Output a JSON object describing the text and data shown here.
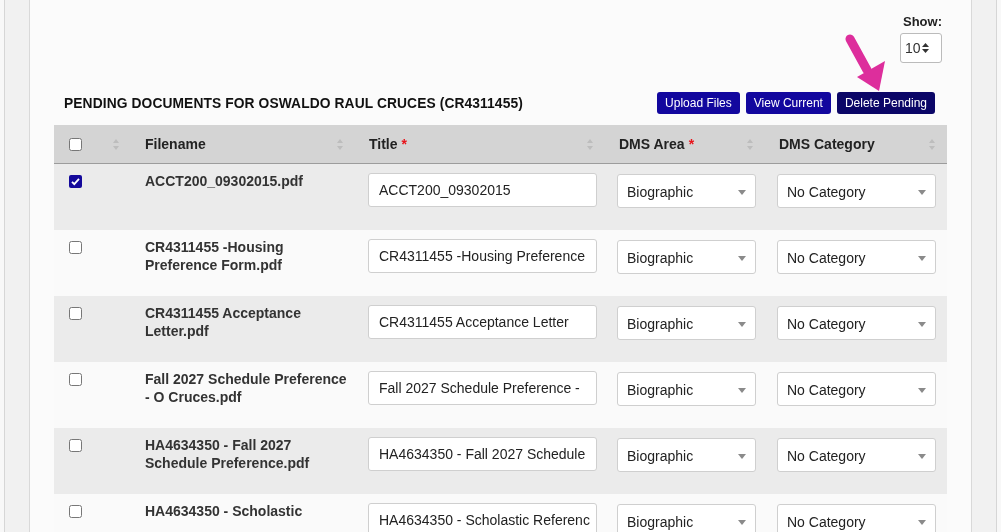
{
  "page_size": {
    "label": "Show:",
    "value": "10"
  },
  "heading": "PENDING DOCUMENTS FOR OSWALDO RAUL CRUCES (CR4311455)",
  "actions": [
    {
      "label": "Upload Files",
      "hovered": false
    },
    {
      "label": "View Current",
      "hovered": false
    },
    {
      "label": "Delete Pending",
      "hovered": true
    }
  ],
  "table": {
    "columns": [
      {
        "kind": "checkbox",
        "checked": false
      },
      {
        "kind": "text",
        "label": "Filename"
      },
      {
        "kind": "text",
        "label": "Title",
        "required_mark": "*"
      },
      {
        "kind": "text",
        "label": "DMS Area",
        "required_mark": "*"
      },
      {
        "kind": "text",
        "label": "DMS Category"
      }
    ],
    "rows": [
      {
        "checked": true,
        "filename": "ACCT200_09302015.pdf",
        "title": "ACCT200_09302015",
        "dms_area": "Biographic",
        "dms_category": "No Category"
      },
      {
        "checked": false,
        "filename": "CR4311455 -Housing Preference Form.pdf",
        "title": "CR4311455 -Housing Preference",
        "dms_area": "Biographic",
        "dms_category": "No Category"
      },
      {
        "checked": false,
        "filename": "CR4311455 Acceptance Letter.pdf",
        "title": "CR4311455 Acceptance Letter",
        "dms_area": "Biographic",
        "dms_category": "No Category"
      },
      {
        "checked": false,
        "filename": "Fall 2027 Schedule Preference - O Cruces.pdf",
        "title": "Fall 2027 Schedule Preference -",
        "dms_area": "Biographic",
        "dms_category": "No Category"
      },
      {
        "checked": false,
        "filename": "HA4634350 - Fall 2027 Schedule Preference.pdf",
        "title": "HA4634350 - Fall 2027 Schedule",
        "dms_area": "Biographic",
        "dms_category": "No Category"
      },
      {
        "checked": false,
        "filename": "HA4634350 - Scholastic",
        "title": "HA4634350 - Scholastic Referenc",
        "dms_area": "Biographic",
        "dms_category": "No Category"
      }
    ]
  }
}
